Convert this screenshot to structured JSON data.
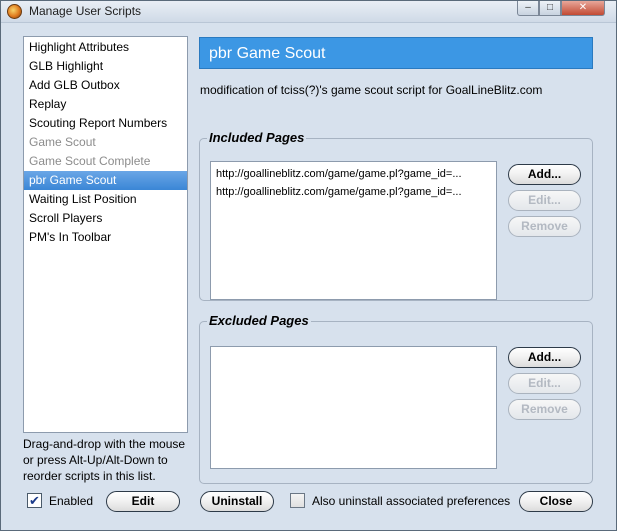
{
  "window": {
    "title": "Manage User Scripts",
    "minimize_icon": "minimize-icon",
    "maximize_icon": "maximize-icon",
    "close_icon": "close-icon"
  },
  "scripts": {
    "items": [
      {
        "label": "Highlight Attributes",
        "state": "enabled"
      },
      {
        "label": "GLB Highlight",
        "state": "enabled"
      },
      {
        "label": "Add GLB Outbox",
        "state": "enabled"
      },
      {
        "label": "Replay",
        "state": "enabled"
      },
      {
        "label": "Scouting Report Numbers",
        "state": "enabled"
      },
      {
        "label": "Game Scout",
        "state": "disabled"
      },
      {
        "label": "Game Scout Complete",
        "state": "disabled"
      },
      {
        "label": "pbr Game Scout",
        "state": "selected"
      },
      {
        "label": "Waiting List Position",
        "state": "enabled"
      },
      {
        "label": "Scroll Players",
        "state": "enabled"
      },
      {
        "label": "PM's In Toolbar",
        "state": "enabled"
      }
    ],
    "help_text": "Drag-and-drop with the mouse or press Alt-Up/Alt-Down to reorder scripts in this list."
  },
  "details": {
    "script_name": "pbr Game Scout",
    "description": "modification of tciss(?)'s game scout script for GoalLineBlitz.com"
  },
  "included": {
    "label": "Included Pages",
    "pages": [
      "http://goallineblitz.com/game/game.pl?game_id=...",
      "http://goallineblitz.com/game/game.pl?game_id=..."
    ],
    "add": "Add...",
    "edit": "Edit...",
    "remove": "Remove"
  },
  "excluded": {
    "label": "Excluded Pages",
    "pages": [],
    "add": "Add...",
    "edit": "Edit...",
    "remove": "Remove"
  },
  "footer": {
    "enabled_label": "Enabled",
    "enabled_checked": true,
    "edit": "Edit",
    "uninstall": "Uninstall",
    "also_uninstall_label": "Also uninstall associated preferences",
    "also_uninstall_checked": false,
    "close": "Close"
  }
}
